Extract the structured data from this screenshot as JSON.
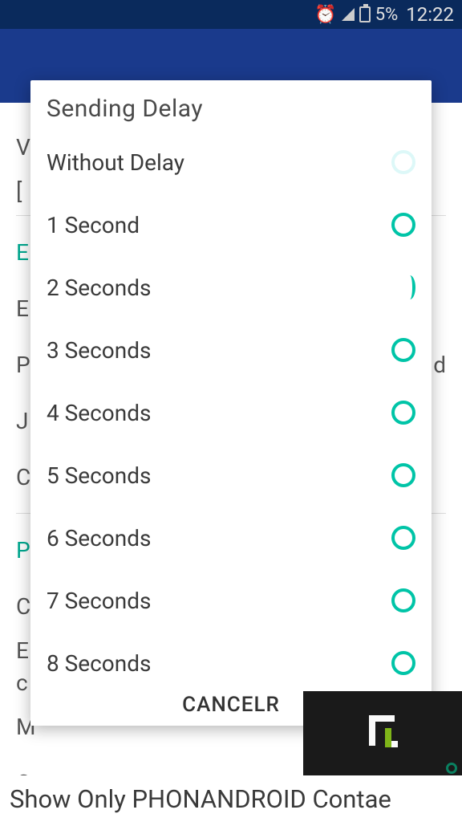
{
  "status_bar": {
    "battery_percent": "5%",
    "time": "12:22"
  },
  "modal": {
    "title": "Sending Delay",
    "options": [
      {
        "label": "Without Delay",
        "selected": true
      },
      {
        "label": "1 Second",
        "selected": false
      },
      {
        "label": "2 Seconds",
        "selected": false
      },
      {
        "label": "3 Seconds",
        "selected": false
      },
      {
        "label": "4 Seconds",
        "selected": false
      },
      {
        "label": "5 Seconds",
        "selected": false
      },
      {
        "label": "6 Seconds",
        "selected": false
      },
      {
        "label": "7 Seconds",
        "selected": false
      },
      {
        "label": "8 Seconds",
        "selected": false
      }
    ],
    "cancel_label": "CANCELR"
  },
  "footer": {
    "text": "Show Only PHONANDROID Contae"
  },
  "background": {
    "line_v": "V",
    "line_bracket": "[",
    "line_e1": "E",
    "line_e2": "E",
    "line_p": "P",
    "line_d": "d",
    "line_j": "J",
    "line_c": "C",
    "line_p2": "P",
    "line_c2": "C",
    "line_e3": "E",
    "line_c3": "c",
    "line_m": "M",
    "line_c4": "C"
  }
}
